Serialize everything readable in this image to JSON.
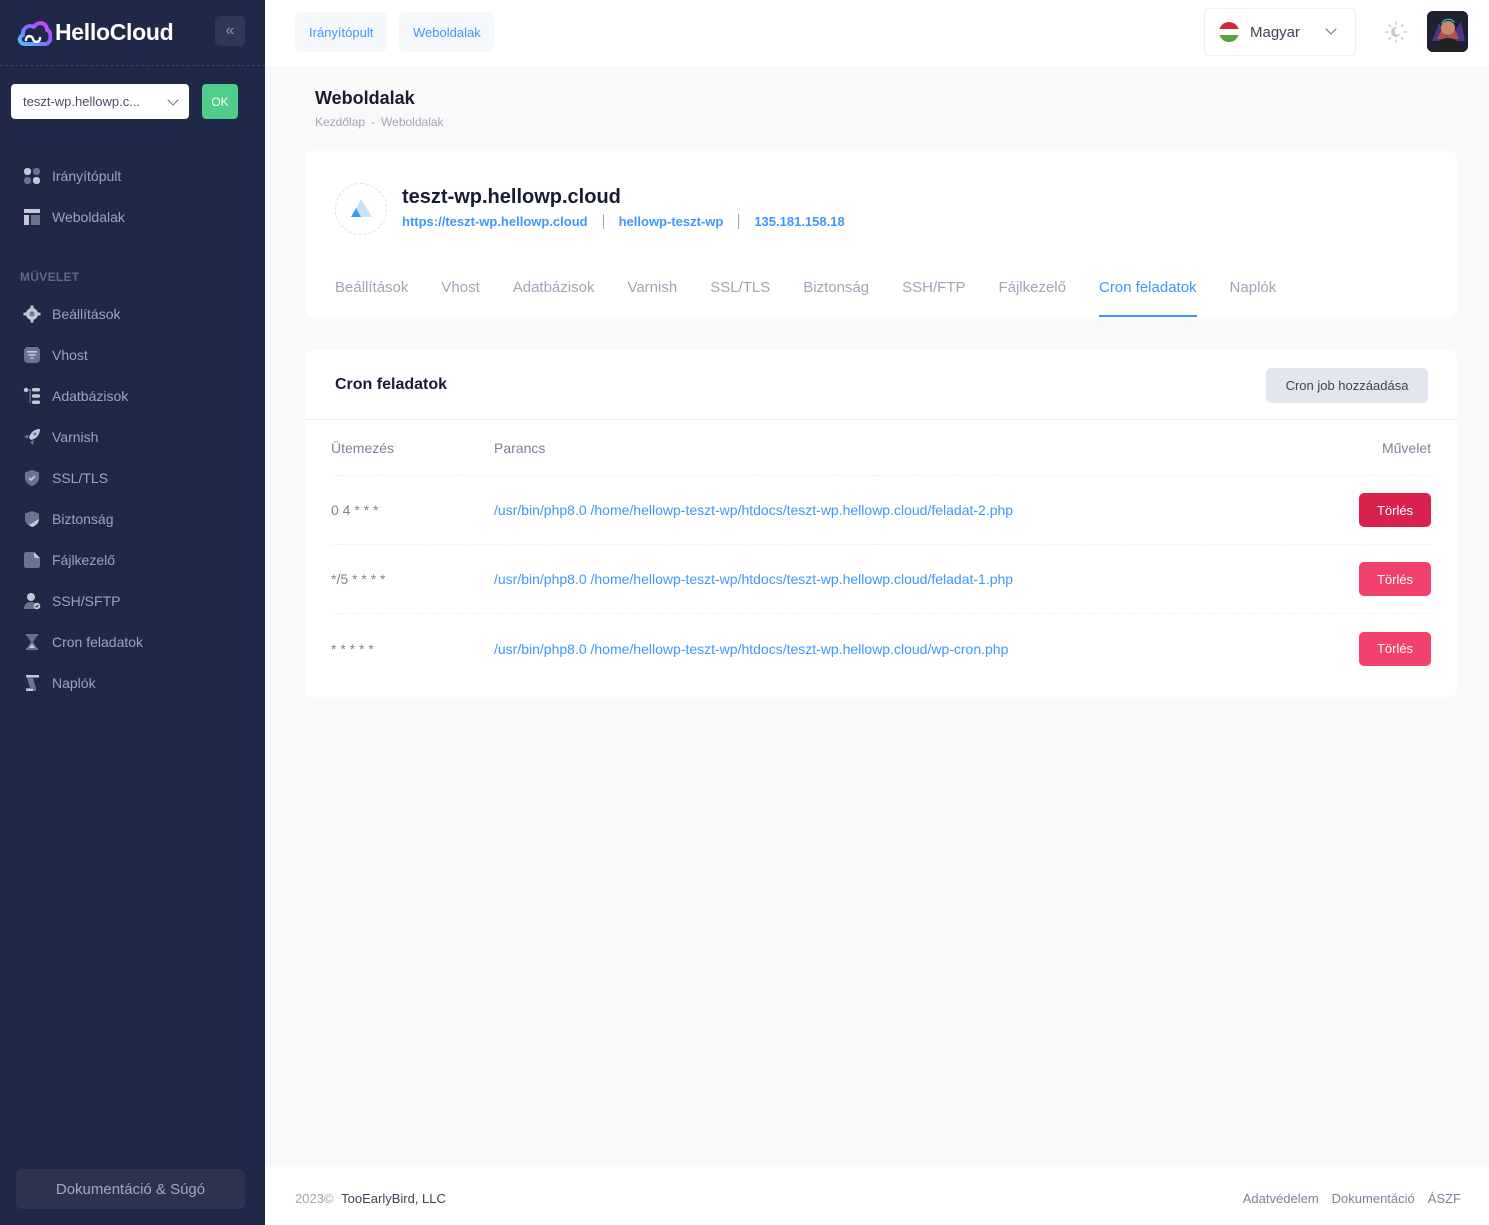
{
  "app": {
    "name": "HelloCloud"
  },
  "sidebar": {
    "site_select": {
      "value": "teszt-wp.hellowp.c..."
    },
    "ok_label": "OK",
    "main_items": [
      {
        "label": "Irányítópult",
        "icon": "dashboard-icon"
      },
      {
        "label": "Weboldalak",
        "icon": "layout-icon"
      }
    ],
    "section_label": "MŰVELET",
    "action_items": [
      {
        "label": "Beállítások",
        "icon": "gear-icon"
      },
      {
        "label": "Vhost",
        "icon": "filter-icon"
      },
      {
        "label": "Adatbázisok",
        "icon": "tree-icon"
      },
      {
        "label": "Varnish",
        "icon": "rocket-icon"
      },
      {
        "label": "SSL/TLS",
        "icon": "shield-check-icon"
      },
      {
        "label": "Biztonság",
        "icon": "shield-icon"
      },
      {
        "label": "Fájlkezelő",
        "icon": "file-icon"
      },
      {
        "label": "SSH/SFTP",
        "icon": "user-check-icon"
      },
      {
        "label": "Cron feladatok",
        "icon": "hourglass-icon"
      },
      {
        "label": "Naplók",
        "icon": "scroll-icon"
      }
    ],
    "doc_button": "Dokumentáció & Súgó"
  },
  "header": {
    "tabs": [
      "Irányítópult",
      "Weboldalak"
    ],
    "language": "Magyar",
    "flag_colors": [
      "#ce2939",
      "#ffffff",
      "#477050"
    ]
  },
  "toolbar": {
    "title": "Weboldalak",
    "breadcrumb": [
      "Kezdőlap",
      "-",
      "Weboldalak"
    ]
  },
  "site": {
    "name": "teszt-wp.hellowp.cloud",
    "url": "https://teszt-wp.hellowp.cloud",
    "user": "hellowp-teszt-wp",
    "ip": "135.181.158.18",
    "tabs": [
      "Beállítások",
      "Vhost",
      "Adatbázisok",
      "Varnish",
      "SSL/TLS",
      "Biztonság",
      "SSH/FTP",
      "Fájlkezelő",
      "Cron feladatok",
      "Naplók"
    ],
    "active_tab": "Cron feladatok"
  },
  "cron": {
    "title": "Cron feladatok",
    "add_button": "Cron job hozzáadása",
    "columns": [
      "Ütemezés",
      "Parancs",
      "Művelet"
    ],
    "rows": [
      {
        "schedule": "0 4 * * *",
        "command": "/usr/bin/php8.0 /home/hellowp-teszt-wp/htdocs/teszt-wp.hellowp.cloud/feladat-2.php",
        "action": "Törlés"
      },
      {
        "schedule": "*/5 * * * *",
        "command": "/usr/bin/php8.0 /home/hellowp-teszt-wp/htdocs/teszt-wp.hellowp.cloud/feladat-1.php",
        "action": "Törlés"
      },
      {
        "schedule": "* * * * *",
        "command": "/usr/bin/php8.0 /home/hellowp-teszt-wp/htdocs/teszt-wp.hellowp.cloud/wp-cron.php",
        "action": "Törlés"
      }
    ]
  },
  "footer": {
    "year": "2023©",
    "company": "TooEarlyBird, LLC",
    "links": [
      "Adatvédelem",
      "Dokumentáció",
      "ÁSZF"
    ]
  },
  "colors": {
    "accent": "#3e97ff",
    "danger": "#f1416c",
    "success": "#50cd89",
    "sidebar_bg": "#1f2846"
  }
}
